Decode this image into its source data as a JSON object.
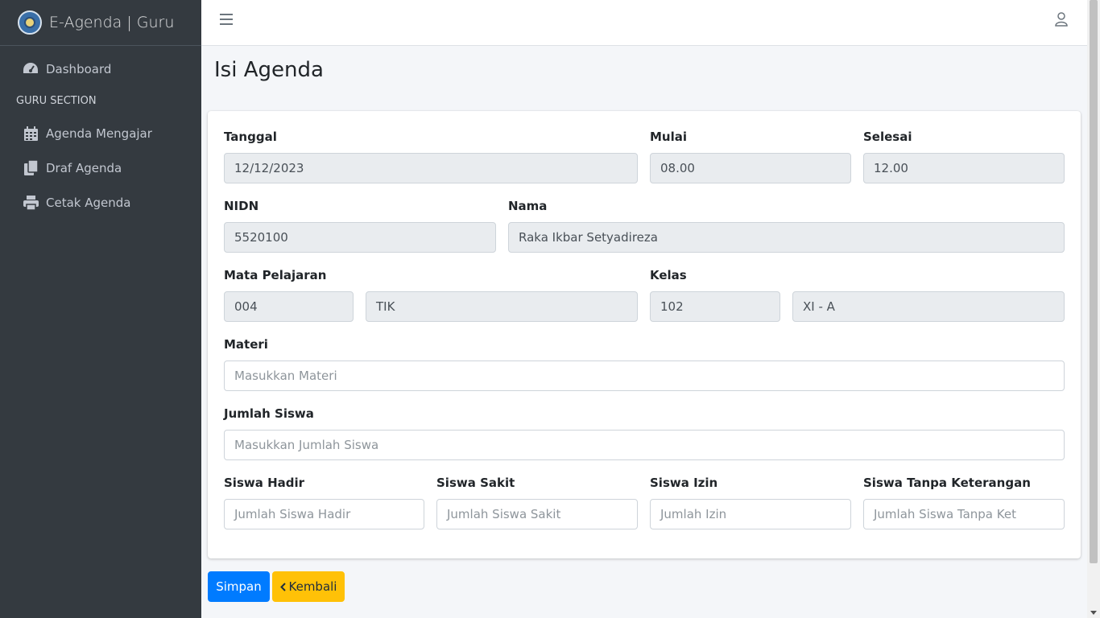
{
  "brand": {
    "title": "E-Agenda | Guru"
  },
  "sidebar": {
    "items": [
      {
        "label": "Dashboard",
        "icon": "tachometer-icon"
      },
      {
        "label": "Agenda Mengajar",
        "icon": "calendar-icon"
      },
      {
        "label": "Draf Agenda",
        "icon": "copy-icon"
      },
      {
        "label": "Cetak Agenda",
        "icon": "print-icon"
      }
    ],
    "section_header": "GURU SECTION"
  },
  "page": {
    "title": "Isi Agenda"
  },
  "form": {
    "tanggal": {
      "label": "Tanggal",
      "value": "12/12/2023"
    },
    "mulai": {
      "label": "Mulai",
      "value": "08.00"
    },
    "selesai": {
      "label": "Selesai",
      "value": "12.00"
    },
    "nidn": {
      "label": "NIDN",
      "value": "5520100"
    },
    "nama": {
      "label": "Nama",
      "value": "Raka Ikbar Setyadireza"
    },
    "mapel": {
      "label": "Mata Pelajaran",
      "code": "004",
      "name": "TIK"
    },
    "kelas": {
      "label": "Kelas",
      "code": "102",
      "name": "XI - A"
    },
    "materi": {
      "label": "Materi",
      "placeholder": "Masukkan Materi"
    },
    "jumlah_siswa": {
      "label": "Jumlah Siswa",
      "placeholder": "Masukkan Jumlah Siswa"
    },
    "hadir": {
      "label": "Siswa Hadir",
      "placeholder": "Jumlah Siswa Hadir"
    },
    "sakit": {
      "label": "Siswa Sakit",
      "placeholder": "Jumlah Siswa Sakit"
    },
    "izin": {
      "label": "Siswa Izin",
      "placeholder": "Jumlah Izin"
    },
    "tanpa_ket": {
      "label": "Siswa Tanpa Keterangan",
      "placeholder": "Jumlah Siswa Tanpa Ket"
    }
  },
  "actions": {
    "save_label": "Simpan",
    "back_label": "Kembali"
  },
  "colors": {
    "primary": "#007bff",
    "warning": "#ffc107",
    "sidebar": "#343a40"
  }
}
